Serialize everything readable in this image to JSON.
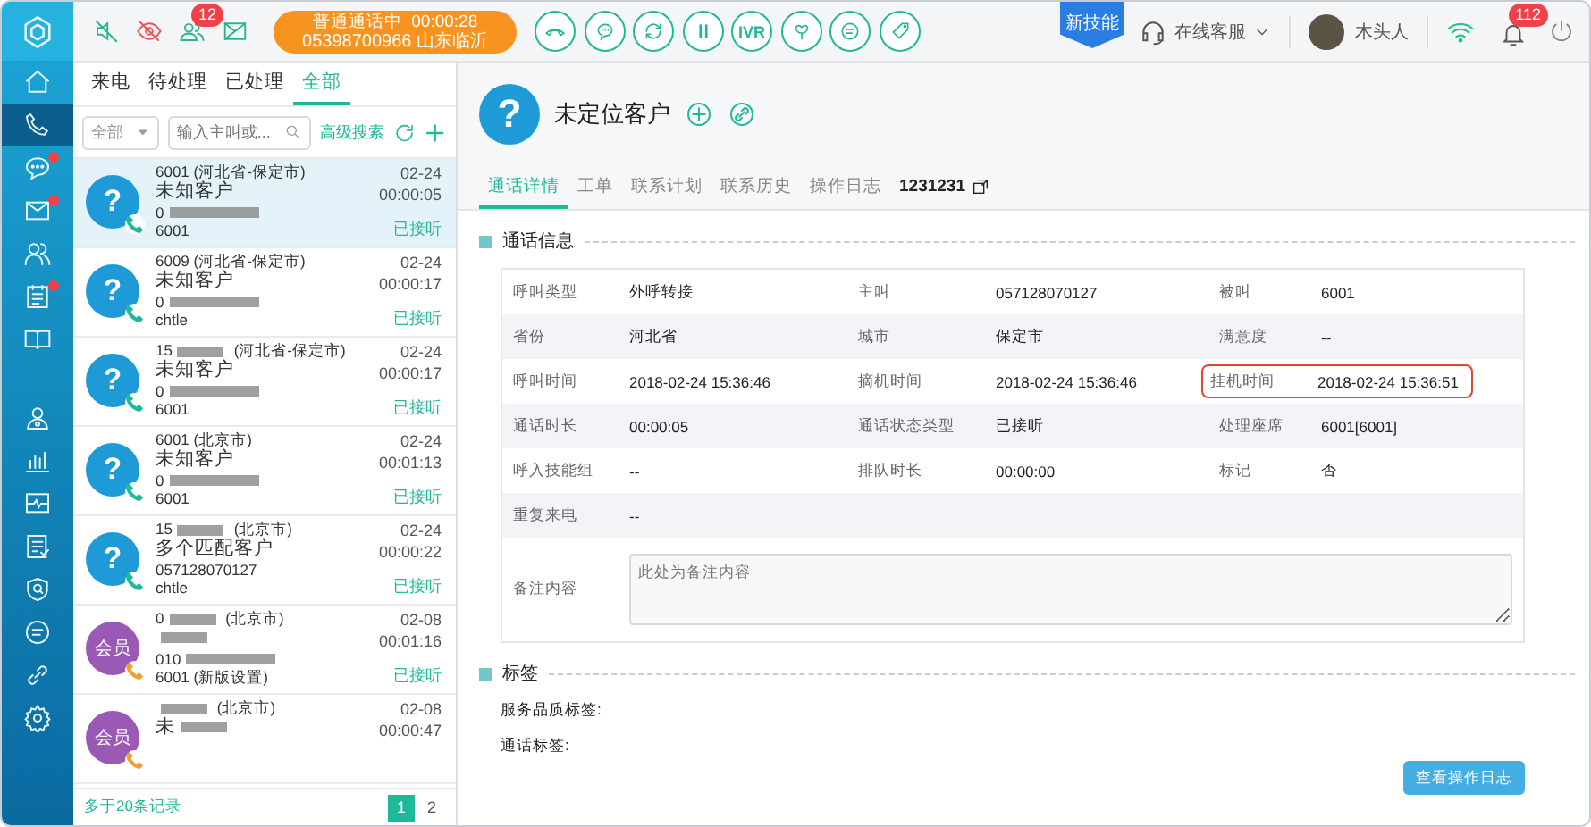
{
  "sidebar": {
    "items": [
      {
        "kind": "home",
        "selected": false,
        "dot": false
      },
      {
        "kind": "phone",
        "selected": true,
        "dot": false
      },
      {
        "kind": "chat",
        "selected": false,
        "dot": true
      },
      {
        "kind": "mail",
        "selected": false,
        "dot": true
      },
      {
        "kind": "contacts",
        "selected": false,
        "dot": false
      },
      {
        "kind": "notes",
        "selected": false,
        "dot": true
      },
      {
        "kind": "book",
        "selected": false,
        "dot": false
      },
      {
        "kind": "agent",
        "selected": false,
        "dot": false
      },
      {
        "kind": "chart",
        "selected": false,
        "dot": false
      },
      {
        "kind": "monitor",
        "selected": false,
        "dot": false
      },
      {
        "kind": "checklist",
        "selected": false,
        "dot": false
      },
      {
        "kind": "shield",
        "selected": false,
        "dot": false
      },
      {
        "kind": "message",
        "selected": false,
        "dot": false
      },
      {
        "kind": "link",
        "selected": false,
        "dot": false
      },
      {
        "kind": "settings",
        "selected": false,
        "dot": false
      }
    ]
  },
  "topbar": {
    "status_icons": [
      {
        "kind": "mute"
      },
      {
        "kind": "no-view"
      },
      {
        "kind": "queue",
        "badge": "12"
      },
      {
        "kind": "no-mail"
      }
    ],
    "call": {
      "status": "普通通话中",
      "timer": "00:00:28",
      "number": "05398700966 山东临沂"
    },
    "call_buttons": [
      {
        "kind": "hangup"
      },
      {
        "kind": "consult"
      },
      {
        "kind": "transfer"
      },
      {
        "kind": "pause"
      },
      {
        "kind": "text",
        "label": "IVR"
      },
      {
        "kind": "satisfaction"
      },
      {
        "kind": "sms"
      },
      {
        "kind": "tag"
      }
    ],
    "new_skill": "新技能",
    "service": "在线客服",
    "user": "木头人",
    "alerts": "112"
  },
  "list": {
    "tabs": [
      {
        "label": "来电",
        "selected": false
      },
      {
        "label": "待处理",
        "selected": false
      },
      {
        "label": "已处理",
        "selected": false
      },
      {
        "label": "全部",
        "selected": true
      }
    ],
    "filter": {
      "select": "全部",
      "placeholder": "输入主叫或...",
      "advanced": "高级搜索"
    },
    "calls": [
      {
        "kind": "unknown",
        "avatar": "?",
        "caller": "6001",
        "caller_redacted": false,
        "region": "(河北省-保定市)",
        "name": "未知客户",
        "name_redacted": false,
        "number": "0",
        "number_redacted": true,
        "agent": "6001",
        "date": "02-24",
        "duration": "00:00:05",
        "status": "已接听",
        "color": "#1fb99a",
        "selected": true
      },
      {
        "kind": "unknown",
        "avatar": "?",
        "caller": "6009",
        "caller_redacted": false,
        "region": "(河北省-保定市)",
        "name": "未知客户",
        "name_redacted": false,
        "number": "0",
        "number_redacted": true,
        "agent": "chtle",
        "date": "02-24",
        "duration": "00:00:17",
        "status": "已接听",
        "color": "#1fb99a",
        "selected": false
      },
      {
        "kind": "unknown",
        "avatar": "?",
        "caller": "15",
        "caller_redacted": true,
        "region": "(河北省-保定市)",
        "name": "未知客户",
        "name_redacted": false,
        "number": "0",
        "number_redacted": true,
        "agent": "6001",
        "date": "02-24",
        "duration": "00:00:17",
        "status": "已接听",
        "color": "#1fb99a",
        "selected": false
      },
      {
        "kind": "unknown",
        "avatar": "?",
        "caller": "6001",
        "caller_redacted": false,
        "region": "(北京市)",
        "name": "未知客户",
        "name_redacted": false,
        "number": "0",
        "number_redacted": true,
        "agent": "6001",
        "date": "02-24",
        "duration": "00:01:13",
        "status": "已接听",
        "color": "#1fb99a",
        "selected": false
      },
      {
        "kind": "unknown",
        "avatar": "?",
        "caller": "15",
        "caller_redacted": true,
        "region": "(北京市)",
        "name": "多个匹配客户",
        "name_redacted": false,
        "number": "057128070127",
        "number_redacted": false,
        "agent": "chtle",
        "date": "02-24",
        "duration": "00:00:22",
        "status": "已接听",
        "color": "#1fb99a",
        "selected": false
      },
      {
        "kind": "member",
        "avatar": "会员",
        "caller": "0",
        "caller_redacted": true,
        "region": "(北京市)",
        "name_redacted": true,
        "number": "010",
        "number_redacted": true,
        "agent": "6001 (新版设置)",
        "date": "02-08",
        "duration": "00:01:16",
        "status": "已接听",
        "color": "#f0a030",
        "selected": false
      },
      {
        "kind": "member",
        "avatar": "会员",
        "caller_redacted": true,
        "region": "(北京市)",
        "name": "未",
        "name_redacted": true,
        "date": "02-08",
        "duration": "00:00:47",
        "color": "#f0a030",
        "selected": false
      }
    ],
    "footer": "多于20条记录",
    "pages": [
      {
        "label": "1",
        "selected": true
      },
      {
        "label": "2",
        "selected": false
      }
    ]
  },
  "detail": {
    "avatar": "?",
    "title": "未定位客户",
    "tabs": [
      {
        "label": "通话详情",
        "selected": true
      },
      {
        "label": "工单",
        "selected": false
      },
      {
        "label": "联系计划",
        "selected": false
      },
      {
        "label": "联系历史",
        "selected": false
      },
      {
        "label": "操作日志",
        "selected": false
      },
      {
        "label": "1231231",
        "selected": false
      }
    ],
    "sections": [
      {
        "title": "通话信息"
      },
      {
        "title": "标签"
      }
    ],
    "table": {
      "rows": [
        [
          {
            "label": "呼叫类型",
            "value": "外呼转接",
            "highlighted": false
          },
          {
            "label": "主叫",
            "value": "057128070127",
            "highlighted": false
          },
          {
            "label": "被叫",
            "value": "6001",
            "highlighted": false
          }
        ],
        [
          {
            "label": "省份",
            "value": "河北省",
            "highlighted": false
          },
          {
            "label": "城市",
            "value": "保定市",
            "highlighted": false
          },
          {
            "label": "满意度",
            "value": "--",
            "highlighted": false
          }
        ],
        [
          {
            "label": "呼叫时间",
            "value": "2018-02-24 15:36:46",
            "highlighted": false
          },
          {
            "label": "摘机时间",
            "value": "2018-02-24 15:36:46",
            "highlighted": false
          },
          {
            "label": "挂机时间",
            "value": "2018-02-24 15:36:51",
            "highlighted": true
          }
        ],
        [
          {
            "label": "通话时长",
            "value": "00:00:05",
            "highlighted": false
          },
          {
            "label": "通话状态类型",
            "value": "已接听",
            "highlighted": false
          },
          {
            "label": "处理座席",
            "value": "6001[6001]",
            "highlighted": false
          }
        ],
        [
          {
            "label": "呼入技能组",
            "value": "--",
            "highlighted": false
          },
          {
            "label": "排队时长",
            "value": "00:00:00",
            "highlighted": false
          },
          {
            "label": "标记",
            "value": "否",
            "highlighted": false
          }
        ],
        [
          {
            "label": "重复来电",
            "value": "--",
            "highlighted": false
          }
        ]
      ],
      "note": {
        "label": "备注内容",
        "placeholder": "此处为备注内容"
      }
    },
    "tags": [
      "服务品质标签:",
      "通话标签:"
    ],
    "button": "查看操作日志"
  }
}
